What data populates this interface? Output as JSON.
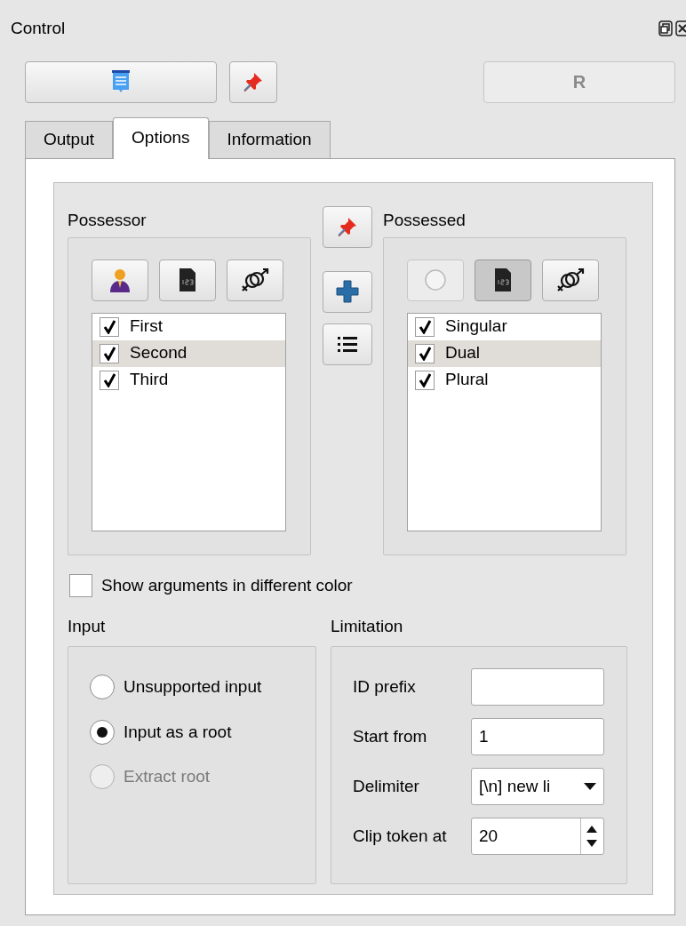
{
  "window": {
    "title": "Control"
  },
  "toolbar": {
    "r_button": {
      "label": "R",
      "disabled": true
    }
  },
  "tabs": [
    {
      "label": "Output",
      "selected": false
    },
    {
      "label": "Options",
      "selected": true
    },
    {
      "label": "Information",
      "selected": false
    }
  ],
  "possessor": {
    "label": "Possessor",
    "filter_buttons": [
      {
        "kind": "person",
        "pressed": false,
        "disabled": false
      },
      {
        "kind": "number",
        "pressed": false,
        "disabled": false
      },
      {
        "kind": "gender",
        "pressed": false,
        "disabled": false
      }
    ],
    "items": [
      {
        "label": "First",
        "checked": true,
        "selected": false
      },
      {
        "label": "Second",
        "checked": true,
        "selected": true
      },
      {
        "label": "Third",
        "checked": true,
        "selected": false
      }
    ]
  },
  "possessed": {
    "label": "Possessed",
    "filter_buttons": [
      {
        "kind": "circle",
        "pressed": false,
        "disabled": true
      },
      {
        "kind": "number",
        "pressed": true,
        "disabled": false
      },
      {
        "kind": "gender",
        "pressed": false,
        "disabled": false
      }
    ],
    "items": [
      {
        "label": "Singular",
        "checked": true,
        "selected": false
      },
      {
        "label": "Dual",
        "checked": true,
        "selected": true
      },
      {
        "label": "Plural",
        "checked": true,
        "selected": false
      }
    ]
  },
  "show_color": {
    "label": "Show arguments in different color",
    "checked": false
  },
  "input": {
    "label": "Input",
    "options": [
      {
        "label": "Unsupported input",
        "selected": false,
        "disabled": false
      },
      {
        "label": "Input as a root",
        "selected": true,
        "disabled": false
      },
      {
        "label": "Extract root",
        "selected": false,
        "disabled": true
      }
    ]
  },
  "limitation": {
    "label": "Limitation",
    "fields": [
      {
        "kind": "text",
        "label": "ID prefix"
      },
      {
        "kind": "text",
        "label": "Start from",
        "value": "1"
      },
      {
        "kind": "select",
        "label": "Delimiter",
        "value": "[\\n] new li"
      },
      {
        "kind": "spin",
        "label": "Clip token at",
        "value": "20"
      }
    ]
  }
}
